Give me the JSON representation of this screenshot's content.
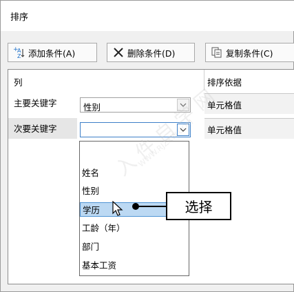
{
  "window": {
    "title": "排序"
  },
  "toolbar": {
    "add_label": "添加条件(A)",
    "delete_label": "删除条件(D)",
    "copy_label": "复制条件(C)"
  },
  "grid": {
    "col_header_column": "列",
    "col_header_sort_on": "排序依据",
    "rows": [
      {
        "label": "主要关键字",
        "column_value": "性别",
        "sort_on": "单元格值"
      },
      {
        "label": "次要关键字",
        "column_value": "",
        "sort_on": "单元格值"
      }
    ]
  },
  "dropdown": {
    "options": [
      "",
      "姓名",
      "性别",
      "学历",
      "工龄（年）",
      "部门",
      "基本工资"
    ],
    "selected": "学历"
  },
  "annotation": {
    "text": "选择"
  },
  "watermark": {
    "text": "入 件 自 学 网",
    "url": "WWW.RJZXW.COM"
  },
  "colors": {
    "selection_bg": "#bcd9f3",
    "selection_border": "#4f94d4",
    "add_icon_blue": "#1e6fc8"
  }
}
